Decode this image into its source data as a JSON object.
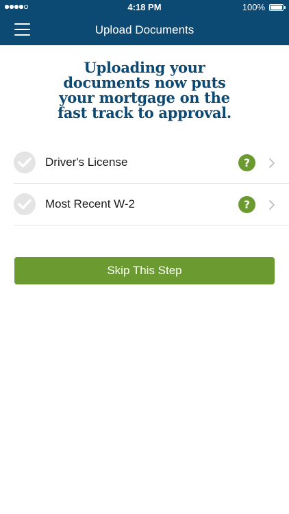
{
  "status_bar": {
    "time": "4:18 PM",
    "battery": "100%",
    "signal_icon": "signal-dots-icon",
    "battery_icon": "battery-icon"
  },
  "nav": {
    "menu_icon": "hamburger-menu-icon",
    "title": "Upload Documents"
  },
  "headline": {
    "lines": [
      "Uploading your",
      "documents now puts",
      "your mortgage on the",
      "fast track to approval."
    ]
  },
  "documents": [
    {
      "label": "Driver's License",
      "status_icon": "check-circle-icon",
      "help_icon": "question-icon",
      "nav_icon": "chevron-right-icon"
    },
    {
      "label": "Most Recent W-2",
      "status_icon": "check-circle-icon",
      "help_icon": "question-icon",
      "nav_icon": "chevron-right-icon"
    }
  ],
  "skip_button": {
    "label": "Skip This Step"
  },
  "colors": {
    "nav_background": "#0d4a73",
    "headline": "#0d4a73",
    "accent_green": "#6b9a30",
    "check_circle": "#e4e4e4",
    "divider": "#e3e3e3"
  }
}
